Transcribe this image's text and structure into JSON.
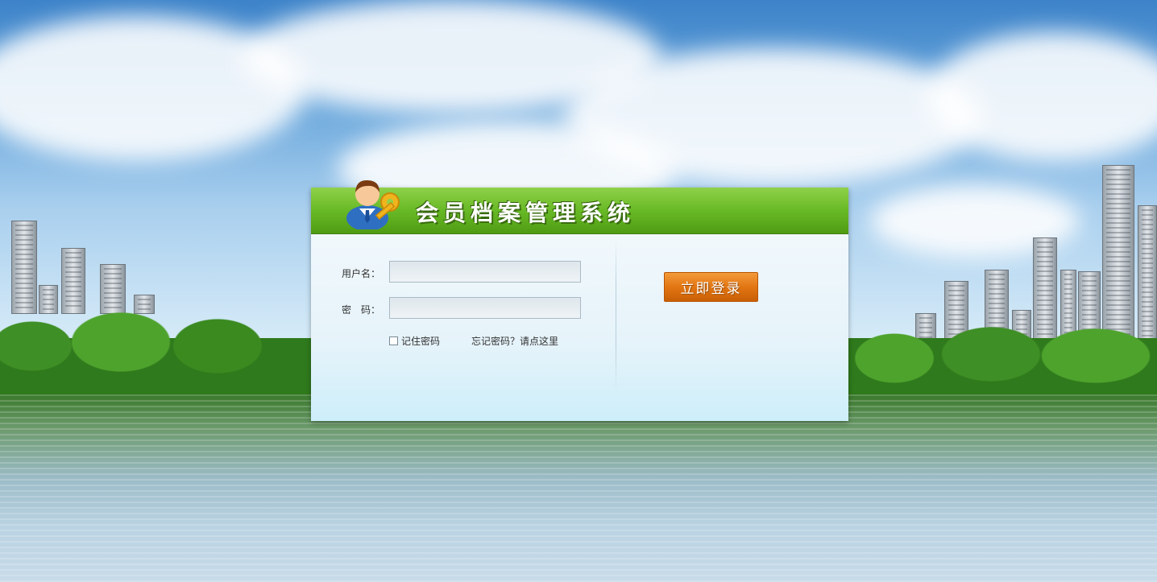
{
  "header": {
    "title": "会员档案管理系统"
  },
  "form": {
    "username_label": "用户名：",
    "password_label": "密　码：",
    "username_value": "",
    "password_value": "",
    "remember_label": "记住密码",
    "forgot_link": "忘记密码？请点这里"
  },
  "login_button": "立即登录",
  "icons": {
    "avatar": "user-key-icon",
    "checkbox": "checkbox-icon"
  },
  "colors": {
    "header_green": "#68b926",
    "button_orange": "#e27613",
    "panel_bg": "#e5f3fa"
  }
}
